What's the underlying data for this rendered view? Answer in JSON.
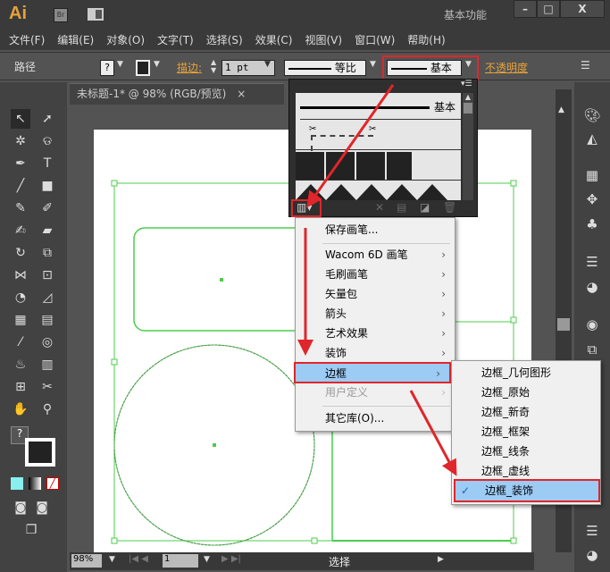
{
  "app": {
    "logo": "Ai",
    "bridge": "Br",
    "workspace": "基本功能",
    "minimize": "–",
    "maximize": "□",
    "close": "X"
  },
  "menubar": [
    "文件(F)",
    "编辑(E)",
    "对象(O)",
    "文字(T)",
    "选择(S)",
    "效果(C)",
    "视图(V)",
    "窗口(W)",
    "帮助(H)"
  ],
  "control": {
    "label": "路径",
    "fill": "?",
    "stroke_label": "描边:",
    "stroke_weight": "1 pt",
    "profile": "等比",
    "brush": "基本",
    "opacity": "不透明度"
  },
  "document": {
    "tab": "未标题-1* @ 98% (RGB/预览)",
    "tab_close": "×"
  },
  "brush_panel": {
    "first_brush": "基本"
  },
  "brush_library_menu": {
    "items": [
      {
        "label": "保存画笔..."
      },
      {
        "label": "Wacom 6D 画笔",
        "sub": true
      },
      {
        "label": "毛刷画笔",
        "sub": true
      },
      {
        "label": "矢量包",
        "sub": true
      },
      {
        "label": "箭头",
        "sub": true
      },
      {
        "label": "艺术效果",
        "sub": true
      },
      {
        "label": "装饰",
        "sub": true
      },
      {
        "label": "边框",
        "sub": true,
        "highlighted": true
      },
      {
        "label": "用户定义",
        "sub": true,
        "disabled": true
      },
      {
        "label": "其它库(O)..."
      }
    ]
  },
  "border_submenu": {
    "items": [
      "边框_几何图形",
      "边框_原始",
      "边框_新奇",
      "边框_框架",
      "边框_线条",
      "边框_虚线",
      "边框_装饰"
    ],
    "checked": "边框_装饰",
    "check": "✓"
  },
  "status": {
    "zoom": "98%",
    "page": "1",
    "tool": "选择"
  },
  "colors": {
    "highlight": "#9ccbf4",
    "annotation": "#e0262a",
    "selection": "#4ccd4c",
    "accent": "#e8a23a"
  }
}
